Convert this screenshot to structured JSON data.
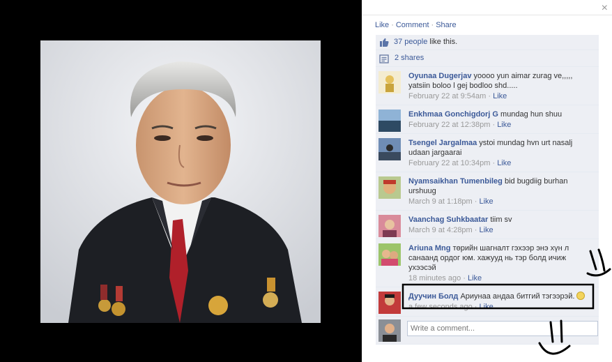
{
  "viewer": {
    "close_label": "×",
    "actions": {
      "like": "Like",
      "comment": "Comment",
      "share": "Share"
    }
  },
  "ufi": {
    "likes": {
      "link": "37 people",
      "text": " like this."
    },
    "shares": {
      "link": "2 shares"
    },
    "comments": [
      {
        "author": "Oyunaa Dugerjav",
        "text": "yoooo yun aimar zurag ve,,,,, yatsiin boloo l gej bodloo shd.....",
        "time": "February 22 at 9:54am",
        "like": "Like"
      },
      {
        "author": "Enkhmaa Gonchigdorj G",
        "text": "mundag hun shuu",
        "time": "February 22 at 12:38pm",
        "like": "Like"
      },
      {
        "author": "Tsengel Jargalmaa",
        "text": "ystoi mundag hvn urt nasalj udaan jargaarai",
        "time": "February 22 at 10:34pm",
        "like": "Like"
      },
      {
        "author": "Nyamsaikhan Tumenbileg",
        "text": "bid bugdiig burhan urshuug",
        "time": "March 9 at 1:18pm",
        "like": "Like"
      },
      {
        "author": "Vaanchag Suhkbaatar",
        "text": "tiim sv",
        "time": "March 9 at 4:28pm",
        "like": "Like"
      },
      {
        "author": "Ariuna Mng",
        "text": "төрийн шагналт гэхээр энэ хүн л санаанд ордог юм. хажууд нь тэр болд ичиж ухээсэй",
        "time": "18 minutes ago",
        "like": "Like"
      },
      {
        "author": "Дуучин Болд",
        "text": "Ариунаа андаа битгий тэгээрэй.",
        "time": "a few seconds ago",
        "like": "Like"
      }
    ],
    "write_placeholder": "Write a comment..."
  },
  "colors": {
    "link": "#3b5998",
    "ufi_bg": "#edeff4",
    "meta": "#999999"
  }
}
